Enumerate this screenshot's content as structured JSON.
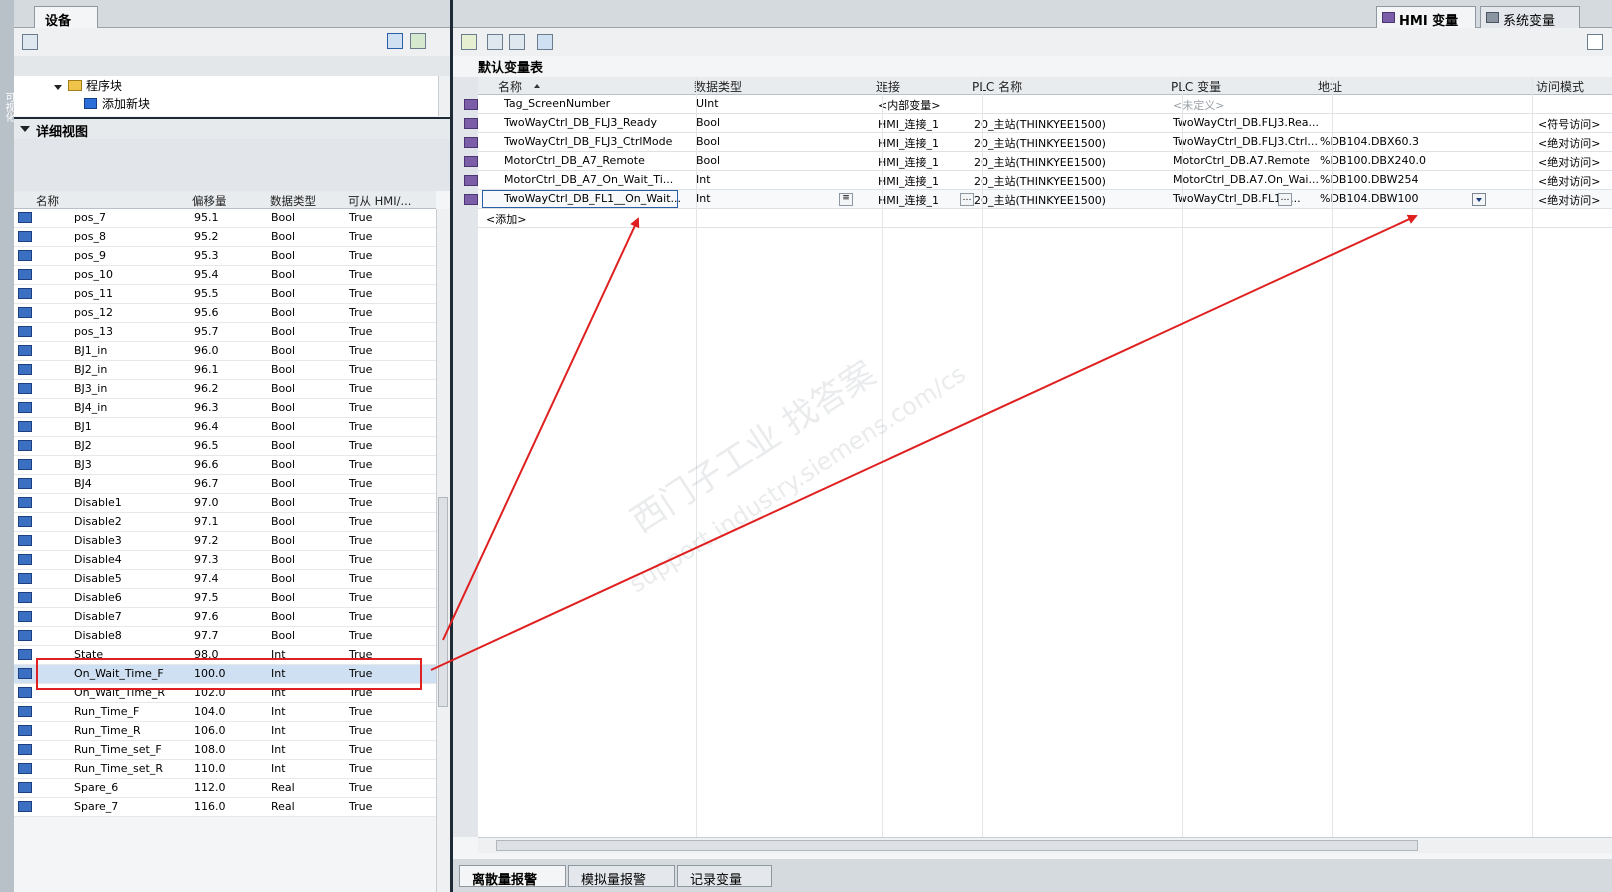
{
  "left_panel": {
    "vertical_label": "可视化",
    "tab": "设备",
    "tree": [
      {
        "label": "程序块"
      },
      {
        "label": "添加新块"
      }
    ],
    "detail_title": "详细视图",
    "columns": [
      "名称",
      "偏移量",
      "数据类型",
      "可从 HMI/..."
    ],
    "rows": [
      {
        "name": "pos_7",
        "offset": "95.1",
        "type": "Bool",
        "hmi": "True"
      },
      {
        "name": "pos_8",
        "offset": "95.2",
        "type": "Bool",
        "hmi": "True"
      },
      {
        "name": "pos_9",
        "offset": "95.3",
        "type": "Bool",
        "hmi": "True"
      },
      {
        "name": "pos_10",
        "offset": "95.4",
        "type": "Bool",
        "hmi": "True"
      },
      {
        "name": "pos_11",
        "offset": "95.5",
        "type": "Bool",
        "hmi": "True"
      },
      {
        "name": "pos_12",
        "offset": "95.6",
        "type": "Bool",
        "hmi": "True"
      },
      {
        "name": "pos_13",
        "offset": "95.7",
        "type": "Bool",
        "hmi": "True"
      },
      {
        "name": "BJ1_in",
        "offset": "96.0",
        "type": "Bool",
        "hmi": "True"
      },
      {
        "name": "BJ2_in",
        "offset": "96.1",
        "type": "Bool",
        "hmi": "True"
      },
      {
        "name": "BJ3_in",
        "offset": "96.2",
        "type": "Bool",
        "hmi": "True"
      },
      {
        "name": "BJ4_in",
        "offset": "96.3",
        "type": "Bool",
        "hmi": "True"
      },
      {
        "name": "BJ1",
        "offset": "96.4",
        "type": "Bool",
        "hmi": "True"
      },
      {
        "name": "BJ2",
        "offset": "96.5",
        "type": "Bool",
        "hmi": "True"
      },
      {
        "name": "BJ3",
        "offset": "96.6",
        "type": "Bool",
        "hmi": "True"
      },
      {
        "name": "BJ4",
        "offset": "96.7",
        "type": "Bool",
        "hmi": "True"
      },
      {
        "name": "Disable1",
        "offset": "97.0",
        "type": "Bool",
        "hmi": "True"
      },
      {
        "name": "Disable2",
        "offset": "97.1",
        "type": "Bool",
        "hmi": "True"
      },
      {
        "name": "Disable3",
        "offset": "97.2",
        "type": "Bool",
        "hmi": "True"
      },
      {
        "name": "Disable4",
        "offset": "97.3",
        "type": "Bool",
        "hmi": "True"
      },
      {
        "name": "Disable5",
        "offset": "97.4",
        "type": "Bool",
        "hmi": "True"
      },
      {
        "name": "Disable6",
        "offset": "97.5",
        "type": "Bool",
        "hmi": "True"
      },
      {
        "name": "Disable7",
        "offset": "97.6",
        "type": "Bool",
        "hmi": "True"
      },
      {
        "name": "Disable8",
        "offset": "97.7",
        "type": "Bool",
        "hmi": "True"
      },
      {
        "name": "State",
        "offset": "98.0",
        "type": "Int",
        "hmi": "True"
      },
      {
        "name": "On_Wait_Time_F",
        "offset": "100.0",
        "type": "Int",
        "hmi": "True"
      },
      {
        "name": "On_Wait_Time_R",
        "offset": "102.0",
        "type": "Int",
        "hmi": "True"
      },
      {
        "name": "Run_Time_F",
        "offset": "104.0",
        "type": "Int",
        "hmi": "True"
      },
      {
        "name": "Run_Time_R",
        "offset": "106.0",
        "type": "Int",
        "hmi": "True"
      },
      {
        "name": "Run_Time_set_F",
        "offset": "108.0",
        "type": "Int",
        "hmi": "True"
      },
      {
        "name": "Run_Time_set_R",
        "offset": "110.0",
        "type": "Int",
        "hmi": "True"
      },
      {
        "name": "Spare_6",
        "offset": "112.0",
        "type": "Real",
        "hmi": "True"
      },
      {
        "name": "Spare_7",
        "offset": "116.0",
        "type": "Real",
        "hmi": "True"
      }
    ],
    "selected_row": "On_Wait_Time_F"
  },
  "right_panel": {
    "tabs": [
      "HMI 变量",
      "系统变量"
    ],
    "active_tab": "HMI 变量",
    "table_title": "默认变量表",
    "columns": [
      "名称",
      "数据类型",
      "连接",
      "PLC 名称",
      "PLC 变量",
      "地址",
      "访问模式"
    ],
    "rows": [
      {
        "name": "Tag_ScreenNumber",
        "type": "UInt",
        "conn": "<内部变量>",
        "plc": "",
        "plc_tag": "<未定义>",
        "addr": "",
        "access": ""
      },
      {
        "name": "TwoWayCtrl_DB_FLJ3_Ready",
        "type": "Bool",
        "conn": "HMI_连接_1",
        "plc": "20_主站(THINKYEE1500)",
        "plc_tag": "TwoWayCtrl_DB.FLJ3.Rea...",
        "addr": "",
        "access": "<符号访问>"
      },
      {
        "name": "TwoWayCtrl_DB_FLJ3_CtrlMode",
        "type": "Bool",
        "conn": "HMI_连接_1",
        "plc": "20_主站(THINKYEE1500)",
        "plc_tag": "TwoWayCtrl_DB.FLJ3.Ctrl...",
        "addr": "%DB104.DBX60.3",
        "access": "<绝对访问>"
      },
      {
        "name": "MotorCtrl_DB_A7_Remote",
        "type": "Bool",
        "conn": "HMI_连接_1",
        "plc": "20_主站(THINKYEE1500)",
        "plc_tag": "MotorCtrl_DB.A7.Remote",
        "addr": "%DB100.DBX240.0",
        "access": "<绝对访问>"
      },
      {
        "name": "MotorCtrl_DB_A7_On_Wait_Ti...",
        "type": "Int",
        "conn": "HMI_连接_1",
        "plc": "20_主站(THINKYEE1500)",
        "plc_tag": "MotorCtrl_DB.A7.On_Wai...",
        "addr": "%DB100.DBW254",
        "access": "<绝对访问>"
      },
      {
        "name": "TwoWayCtrl_DB_FL1__On_Wait...",
        "type": "Int",
        "conn": "HMI_连接_1",
        "plc": "20_主站(THINKYEE1500)",
        "plc_tag": "TwoWayCtrl_DB.FL1_....",
        "addr": "%DB104.DBW100",
        "access": "<绝对访问>"
      }
    ],
    "add_row": "<添加>",
    "bottom_tabs": [
      "离散量报警",
      "模拟量报警",
      "记录变量"
    ],
    "active_bottom_tab": "离散量报警"
  },
  "watermark": {
    "line1": "西门子工业   找答案",
    "line2": "support.industry.siemens.com/cs"
  },
  "colors": {
    "annotation": "#e02020",
    "selection": "#cfe0f3"
  }
}
